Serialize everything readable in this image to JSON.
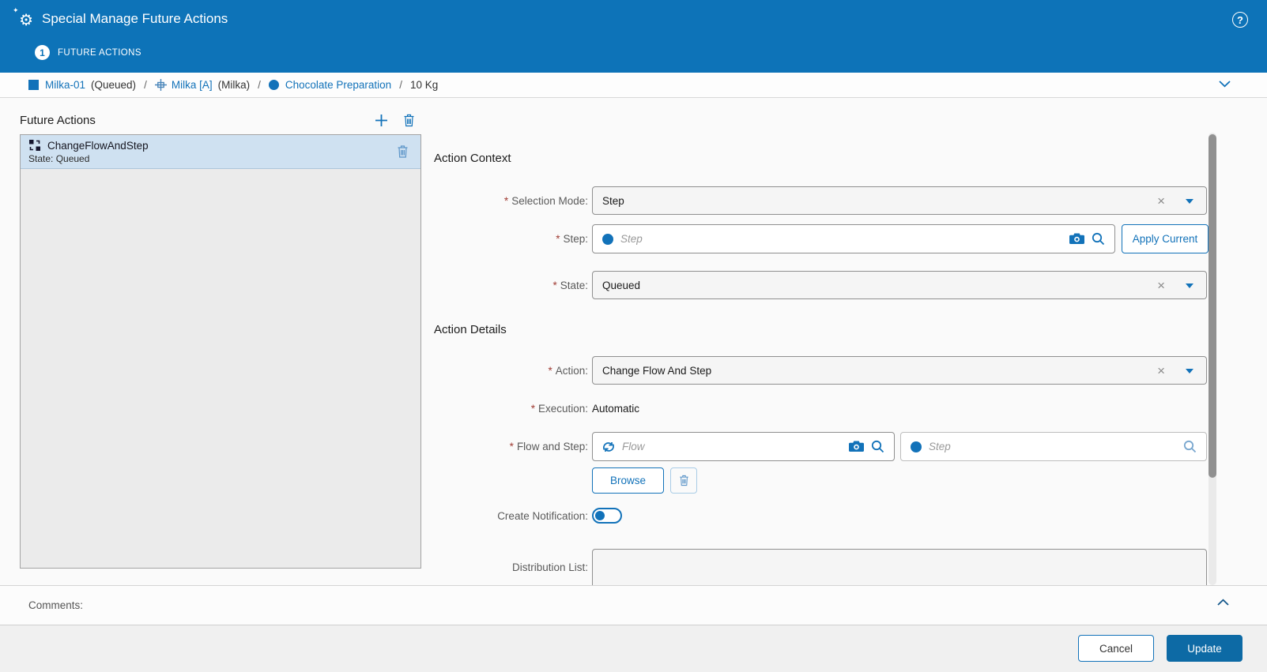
{
  "colors": {
    "header_blue": "#0d73b8",
    "link_blue": "#1272b9",
    "selected_item_bg": "#cfe1f1",
    "required_marker_red": "#a03c34",
    "update_button_bg": "#0d6aa5",
    "list_bg": "#ebebeb"
  },
  "icons": {
    "gear": "⚙",
    "sparkle": "✦",
    "help": "?",
    "clear": "×"
  },
  "titlebar": {
    "title": "Special Manage Future Actions"
  },
  "wizard": {
    "step_number": "1",
    "step_label": "FUTURE ACTIONS"
  },
  "breadcrumb": {
    "separator": "/",
    "items": [
      {
        "icon": "material-square-icon",
        "link": "Milka-01",
        "suffix": "(Queued)"
      },
      {
        "icon": "flow-icon",
        "link": "Milka [A]",
        "suffix": "(Milka)"
      },
      {
        "icon": "step-circle-icon",
        "link": "Chocolate Preparation",
        "suffix": ""
      }
    ],
    "quantity": "10 Kg"
  },
  "left_panel": {
    "title": "Future Actions",
    "items": [
      {
        "name": "ChangeFlowAndStep",
        "state": "State: Queued"
      }
    ]
  },
  "form": {
    "required_marker": "*",
    "context_heading": "Action Context",
    "details_heading": "Action Details",
    "apply_current_label": "Apply Current",
    "browse_label": "Browse",
    "fields": {
      "selection_mode": {
        "label": "Selection Mode:",
        "value": "Step"
      },
      "step": {
        "label": "Step:",
        "placeholder": "Step"
      },
      "state": {
        "label": "State:",
        "value": "Queued"
      },
      "action": {
        "label": "Action:",
        "value": "Change Flow And Step"
      },
      "execution": {
        "label": "Execution:",
        "value": "Automatic"
      },
      "flow_and_step": {
        "label": "Flow and Step:",
        "flow_placeholder": "Flow",
        "step_placeholder": "Step"
      },
      "create_notification": {
        "label": "Create Notification:"
      },
      "distribution_list": {
        "label": "Distribution List:",
        "value": ""
      }
    }
  },
  "comments": {
    "label": "Comments:"
  },
  "footer": {
    "cancel_label": "Cancel",
    "update_label": "Update"
  }
}
